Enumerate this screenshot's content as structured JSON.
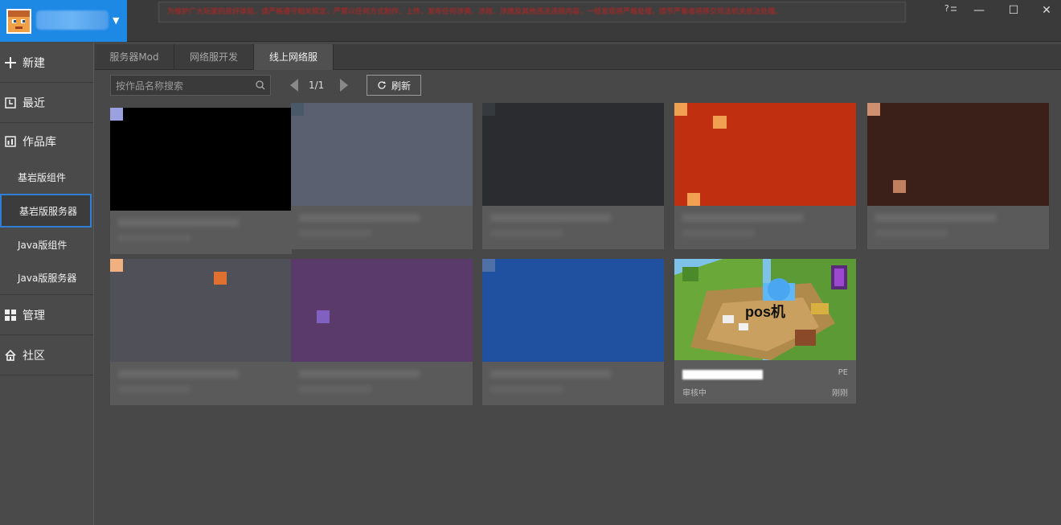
{
  "titlebar": {
    "notice": "为维护广大玩家的良好体验，请严格遵守相关规定，严禁以任何方式制作、上传、发布任何涉黄、涉政、涉赌及其他违法违规内容，一经发现将严格处理，情节严重者将移交司法机关依法处理。",
    "help_icon": "?",
    "minimize": "—",
    "maximize": "☐",
    "close": "✕"
  },
  "sidebar": {
    "items": [
      {
        "label": "新建",
        "icon": "plus-icon"
      },
      {
        "label": "最近",
        "icon": "clock-icon"
      },
      {
        "label": "作品库",
        "icon": "library-icon"
      }
    ],
    "sub_items": [
      "基岩版组件",
      "基岩版服务器",
      "Java版组件",
      "Java版服务器"
    ],
    "active_sub": "基岩版服务器",
    "bottom_items": [
      {
        "label": "管理",
        "icon": "grid-icon"
      },
      {
        "label": "社区",
        "icon": "home-icon"
      }
    ]
  },
  "tabs": [
    "服务器Mod",
    "网络服开发",
    "线上网络服"
  ],
  "active_tab": "线上网络服",
  "toolbar": {
    "search_placeholder": "按作品名称搜索",
    "page": "1/1",
    "refresh_label": "刷新"
  },
  "featured_card": {
    "title": "pos机",
    "tag": "PE",
    "status": "审核中",
    "time": "刚刚"
  },
  "colors": {
    "accent": "#1e88e5",
    "background": "#484848",
    "notice_text": "#c02020"
  }
}
